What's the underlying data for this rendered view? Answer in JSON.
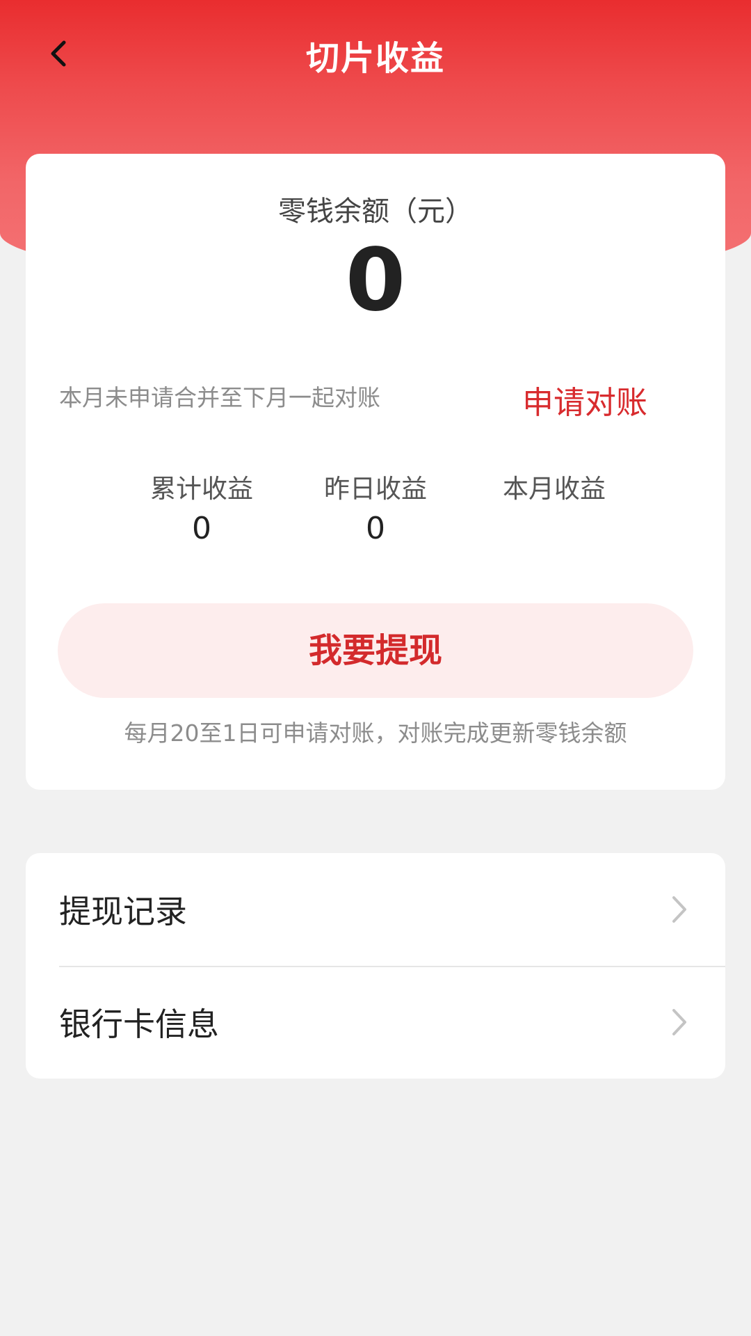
{
  "header": {
    "title": "切片收益",
    "back_icon": "back-arrow-icon"
  },
  "balance_card": {
    "balance_label": "零钱余额（元）",
    "balance_value": "0",
    "notice": "本月未申请合并至下月一起对账",
    "apply_reconcile_label": "申请对账",
    "stats": [
      {
        "label": "累计收益",
        "value": "0"
      },
      {
        "label": "昨日收益",
        "value": "0"
      },
      {
        "label": "本月收益",
        "value": ""
      }
    ],
    "withdraw_label": "我要提现",
    "withdraw_hint": "每月20至1日可申请对账，对账完成更新零钱余额"
  },
  "menu": {
    "items": [
      {
        "label": "提现记录",
        "icon": "chevron-right-icon"
      },
      {
        "label": "银行卡信息",
        "icon": "chevron-right-icon"
      }
    ]
  },
  "colors": {
    "header_red": "#e92d2f",
    "accent_red": "#d82b2e",
    "withdraw_bg": "#fdeded",
    "page_bg": "#f1f1f1"
  }
}
